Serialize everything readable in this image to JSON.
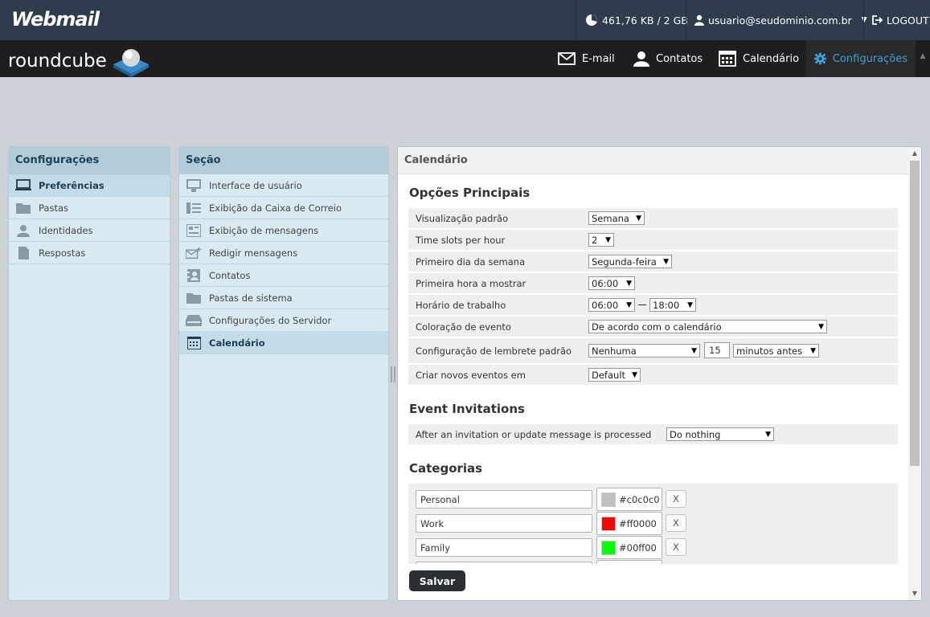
{
  "topbar": {
    "logo": "Webmail",
    "quota": "461,76 KB / 2 GB",
    "user": "usuario@seudominio.com.br",
    "logout": "LOGOUT"
  },
  "navbar": {
    "logo": "roundcube",
    "tabs": [
      {
        "label": "E-mail"
      },
      {
        "label": "Contatos"
      },
      {
        "label": "Calendário"
      },
      {
        "label": "Configurações"
      }
    ]
  },
  "config_panel": {
    "title": "Configurações",
    "items": [
      {
        "label": "Preferências",
        "icon": "laptop-icon"
      },
      {
        "label": "Pastas",
        "icon": "folder-icon"
      },
      {
        "label": "Identidades",
        "icon": "person-icon"
      },
      {
        "label": "Respostas",
        "icon": "document-icon"
      }
    ]
  },
  "section_panel": {
    "title": "Seção",
    "items": [
      {
        "label": "Interface de usuário"
      },
      {
        "label": "Exibição da Caixa de Correio"
      },
      {
        "label": "Exibição de mensagens"
      },
      {
        "label": "Redigir mensagens"
      },
      {
        "label": "Contatos"
      },
      {
        "label": "Pastas de sistema"
      },
      {
        "label": "Configurações do Servidor"
      },
      {
        "label": "Calendário"
      }
    ]
  },
  "main": {
    "title": "Calendário",
    "main_options": {
      "title": "Opções Principais",
      "default_view": {
        "label": "Visualização padrão",
        "value": "Semana"
      },
      "time_slots": {
        "label": "Time slots per hour",
        "value": "2"
      },
      "first_day": {
        "label": "Primeiro dia da semana",
        "value": "Segunda-feira"
      },
      "first_hour": {
        "label": "Primeira hora a mostrar",
        "value": "06:00"
      },
      "work_hours": {
        "label": "Horário de trabalho",
        "start": "06:00",
        "end": "18:00"
      },
      "event_coloring": {
        "label": "Coloração de evento",
        "value": "De acordo com o calendário"
      },
      "reminder": {
        "label": "Configuração de lembrete padrão",
        "type": "Nenhuma",
        "amount": "15",
        "unit": "minutos antes"
      },
      "new_events": {
        "label": "Criar novos eventos em",
        "value": "Default"
      }
    },
    "invitations": {
      "title": "Event Invitations",
      "after_processed": {
        "label": "After an invitation or update message is processed",
        "value": "Do nothing"
      }
    },
    "categories": {
      "title": "Categorias",
      "items": [
        {
          "name": "Personal",
          "color": "#c0c0c0"
        },
        {
          "name": "Work",
          "color": "#ff0000"
        },
        {
          "name": "Family",
          "color": "#00ff00"
        }
      ],
      "remove_label": "X"
    },
    "save_label": "Salvar"
  },
  "colors": {
    "topbar_bg": "#2f3c4d",
    "navbar_bg": "#1e1e1e",
    "accent": "#37a3e0"
  }
}
